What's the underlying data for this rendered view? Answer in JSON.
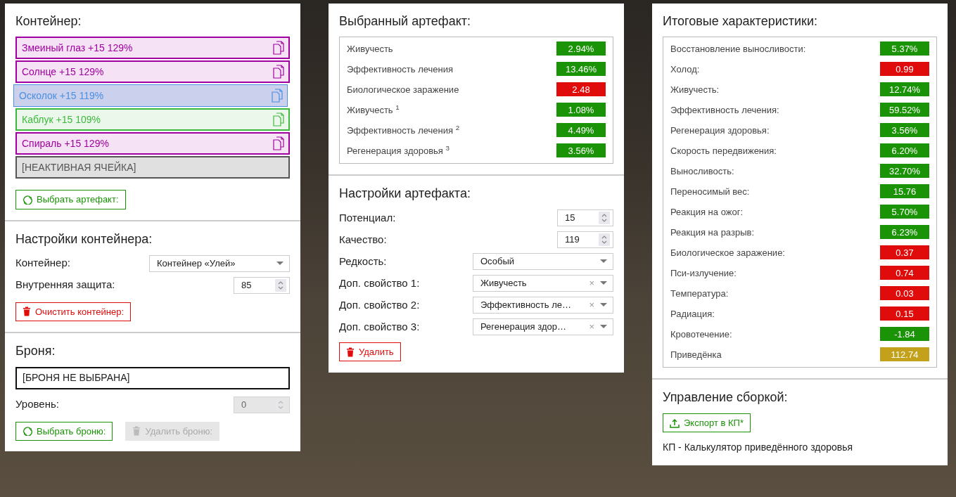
{
  "container_panel": {
    "title": "Контейнер:",
    "slots": [
      {
        "label": "Змеиный глаз +15 129%",
        "kind": "artifact",
        "color": "#a000a0",
        "selected": false
      },
      {
        "label": "Солнце +15 129%",
        "kind": "artifact",
        "color": "#a000a0",
        "selected": false
      },
      {
        "label": "Осколок +15 119%",
        "kind": "artifact",
        "color": "#4a90e2",
        "selected": true
      },
      {
        "label": "Каблук +15 109%",
        "kind": "artifact",
        "color": "#3cb93c",
        "selected": false
      },
      {
        "label": "Спираль +15 129%",
        "kind": "artifact",
        "color": "#a000a0",
        "selected": false
      },
      {
        "label": "[НЕАКТИВНАЯ ЯЧЕЙКА]",
        "kind": "inactive",
        "selected": false
      }
    ],
    "buttons": [
      {
        "label": "Выбрать артефакт:",
        "kind": "select",
        "disabled": false
      }
    ]
  },
  "container_settings": {
    "title": "Настройки контейнера:",
    "fields": [
      {
        "label": "Контейнер:",
        "kind": "select",
        "value": "Контейнер «Улей»"
      },
      {
        "label": "Внутренняя защита:",
        "kind": "number",
        "value": "85",
        "disabled": false
      }
    ],
    "buttons": [
      {
        "label": "Очистить контейнер:",
        "kind": "delete",
        "disabled": false
      }
    ]
  },
  "armor": {
    "title": "Броня:",
    "armor_name": "[БРОНЯ НЕ ВЫБРАНА]",
    "fields": [
      {
        "label": "Уровень:",
        "kind": "number",
        "value": "0",
        "disabled": true
      }
    ],
    "buttons": [
      {
        "label": "Выбрать броню:",
        "kind": "select",
        "disabled": false
      },
      {
        "label": "Удалить броню:",
        "kind": "delete",
        "disabled": true
      }
    ]
  },
  "selected_artifact": {
    "title": "Выбранный артефакт:",
    "stats": [
      {
        "label": "Живучесть",
        "value": "2.94%",
        "color": "#1a9306"
      },
      {
        "label": "Эффективность лечения",
        "value": "13.46%",
        "color": "#1a9306"
      },
      {
        "label": "Биологическое заражение",
        "value": "2.48",
        "color": "#e00b0b"
      },
      {
        "label": "Живучесть $^{1}$",
        "value": "1.08%",
        "color": "#1a9306"
      },
      {
        "label": "Эффективность лечения $^{2}$",
        "value": "4.49%",
        "color": "#1a9306"
      },
      {
        "label": "Регенерация здоровья $^{3}$",
        "value": "3.56%",
        "color": "#1a9306"
      }
    ]
  },
  "artifact_settings": {
    "title": "Настройки артефакта:",
    "fields": [
      {
        "label": "Потенциал:",
        "kind": "number",
        "value": "15",
        "disabled": false
      },
      {
        "label": "Качество:",
        "kind": "number",
        "value": "119",
        "disabled": false
      },
      {
        "label": "Редкость:",
        "kind": "select",
        "value": "Особый"
      },
      {
        "label": "Доп. свойство 1:",
        "kind": "select",
        "value": "Живучесть",
        "clear_mark": "×"
      },
      {
        "label": "Доп. свойство 2:",
        "kind": "select",
        "value": "Эффективность ле…",
        "clear_mark": "×"
      },
      {
        "label": "Доп. свойство 3:",
        "kind": "select",
        "value": "Регенерация здор…",
        "clear_mark": "×"
      }
    ],
    "buttons": [
      {
        "label": "Удалить",
        "kind": "delete",
        "disabled": false
      }
    ]
  },
  "totals": {
    "title": "Итоговые характеристики:",
    "stats": [
      {
        "label": "Восстановление выносливости:",
        "value": "5.37%",
        "color": "#1a9306"
      },
      {
        "label": "Холод:",
        "value": "0.99",
        "color": "#e00b0b"
      },
      {
        "label": "Живучесть:",
        "value": "12.74%",
        "color": "#1a9306"
      },
      {
        "label": "Эффективность лечения:",
        "value": "59.52%",
        "color": "#1a9306"
      },
      {
        "label": "Регенерация здоровья:",
        "value": "3.56%",
        "color": "#1a9306"
      },
      {
        "label": "Скорость передвижения:",
        "value": "6.20%",
        "color": "#1a9306"
      },
      {
        "label": "Выносливость:",
        "value": "32.70%",
        "color": "#1a9306"
      },
      {
        "label": "Переносимый вес:",
        "value": "15.76",
        "color": "#1a9306"
      },
      {
        "label": "Реакция на ожог:",
        "value": "5.70%",
        "color": "#1a9306"
      },
      {
        "label": "Реакция на разрыв:",
        "value": "6.23%",
        "color": "#1a9306"
      },
      {
        "label": "Биологическое заражение:",
        "value": "0.37",
        "color": "#e00b0b"
      },
      {
        "label": "Пси-излучение:",
        "value": "0.74",
        "color": "#e00b0b"
      },
      {
        "label": "Температура:",
        "value": "0.03",
        "color": "#e00b0b"
      },
      {
        "label": "Радиация:",
        "value": "0.15",
        "color": "#e00b0b"
      },
      {
        "label": "Кровотечение:",
        "value": "-1.84",
        "color": "#1a9306"
      },
      {
        "label": "Приведёнка",
        "value": "112.74",
        "color": "#c4a11a"
      }
    ]
  },
  "build_management": {
    "title": "Управление сборкой:",
    "buttons": [
      {
        "label": "Экспорт в КП*",
        "kind": "export",
        "disabled": false
      }
    ],
    "note": "КП - Калькулятор приведённого здоровья"
  }
}
